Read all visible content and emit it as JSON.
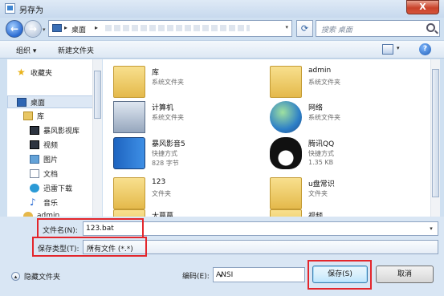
{
  "window": {
    "title": "另存为",
    "close_label": "X"
  },
  "address": {
    "crumb": "桌面",
    "search_placeholder": "搜索 桌面"
  },
  "toolbar": {
    "organize": "组织 ▾",
    "new_folder": "新建文件夹",
    "help": "?"
  },
  "nav": {
    "favorites": "收藏夹",
    "desktop": "桌面",
    "library": "库",
    "items": [
      "暴风影视库",
      "视频",
      "图片",
      "文档",
      "迅雷下载",
      "音乐"
    ],
    "user": "admin"
  },
  "files": [
    {
      "name": "库",
      "line1": "系统文件夹",
      "line2": "",
      "icon": "library-folder-icon"
    },
    {
      "name": "admin",
      "line1": "系统文件夹",
      "line2": "",
      "icon": "user-folder-icon"
    },
    {
      "name": "计算机",
      "line1": "系统文件夹",
      "line2": "",
      "icon": "computer-icon"
    },
    {
      "name": "网络",
      "line1": "系统文件夹",
      "line2": "",
      "icon": "network-globe-icon"
    },
    {
      "name": "暴风影音5",
      "line1": "快捷方式",
      "line2": "828 字节",
      "icon": "baofeng-icon"
    },
    {
      "name": "腾讯QQ",
      "line1": "快捷方式",
      "line2": "1.35 KB",
      "icon": "qq-penguin-icon"
    },
    {
      "name": "123",
      "line1": "文件夹",
      "line2": "",
      "icon": "folder-icon"
    },
    {
      "name": "u盘常识",
      "line1": "文件夹",
      "line2": "",
      "icon": "folder-icon"
    },
    {
      "name": "大蔓蔓",
      "line1": "",
      "line2": "",
      "icon": "folder-icon"
    },
    {
      "name": "视频",
      "line1": "",
      "line2": "",
      "icon": "folder-icon"
    }
  ],
  "form": {
    "filename_label": "文件名(N):",
    "filename_value": "123.bat",
    "type_label": "保存类型(T):",
    "type_value": "所有文件  (*.*)",
    "hide_folders": "隐藏文件夹",
    "encoding_label": "编码(E):",
    "encoding_value": "ANSI",
    "save": "保存(S)",
    "cancel": "取消"
  }
}
